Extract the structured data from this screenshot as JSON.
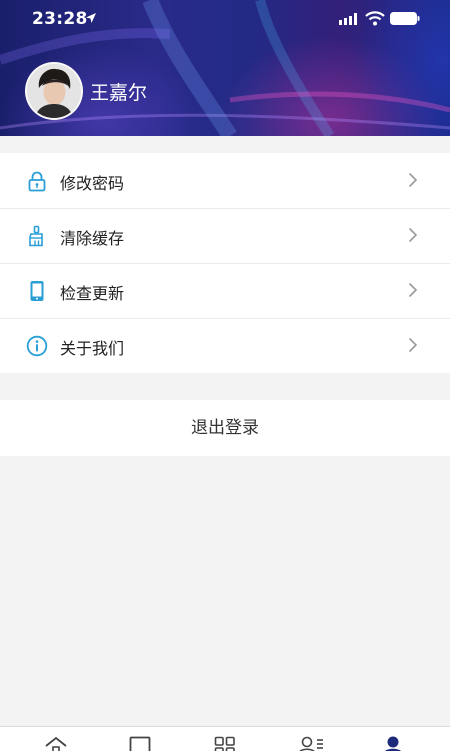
{
  "status_bar": {
    "time": "23:28"
  },
  "profile": {
    "name": "王嘉尔"
  },
  "menu": [
    {
      "label": "修改密码",
      "icon": "lock-icon"
    },
    {
      "label": "清除缓存",
      "icon": "brush-icon"
    },
    {
      "label": "检查更新",
      "icon": "phone-icon"
    },
    {
      "label": "关于我们",
      "icon": "info-icon"
    }
  ],
  "logout": {
    "label": "退出登录"
  },
  "tabbar": {
    "tabs": [
      {
        "icon": "home-icon"
      },
      {
        "icon": "square-icon"
      },
      {
        "icon": "grid-icon"
      },
      {
        "icon": "contacts-icon"
      },
      {
        "icon": "user-icon",
        "active": true
      }
    ]
  },
  "colors": {
    "accent": "#2a9fd6",
    "header_dark": "#1a1f6b",
    "tab_active": "#1e2a7a"
  }
}
